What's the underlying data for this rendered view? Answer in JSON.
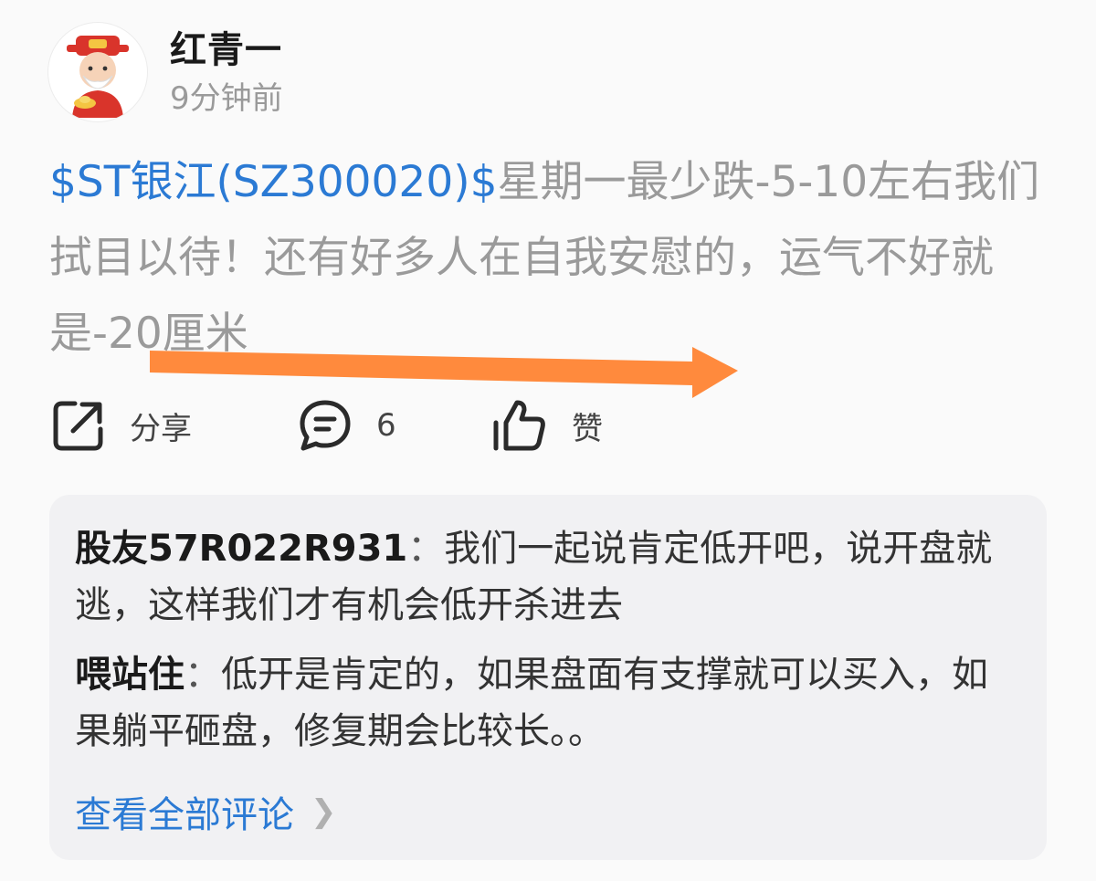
{
  "author": {
    "name": "红青一",
    "time": "9分钟前",
    "avatar": "god-of-wealth-avatar"
  },
  "post": {
    "stock_tag": "$ST银江(SZ300020)$",
    "text": "星期一最少跌-5-10左右我们拭目以待！还有好多人在自我安慰的，运气不好就是-20厘米",
    "annotation": "orange-arrow-underline"
  },
  "actions": {
    "share_label": "分享",
    "comment_count": "6",
    "like_label": "赞"
  },
  "comments": [
    {
      "author": "股友57R022R931",
      "separator": "：",
      "text": "我们一起说肯定低开吧，说开盘就逃，这样我们才有机会低开杀进去"
    },
    {
      "author": "喂站住",
      "separator": "：",
      "text": "低开是肯定的，如果盘面有支撑就可以买入，如果躺平砸盘，修复期会比较长。。"
    }
  ],
  "view_all_label": "查看全部评论",
  "colors": {
    "link_blue": "#2b7ad4",
    "post_gray": "#9a9a9a",
    "arrow_orange": "#ff8a3d",
    "comment_bg": "#f1f1f3"
  }
}
